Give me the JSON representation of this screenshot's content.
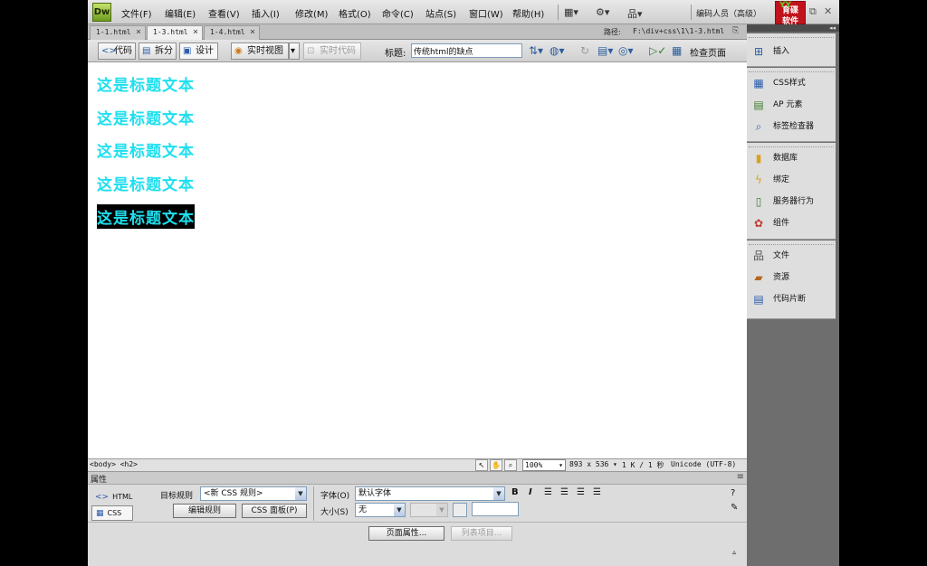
{
  "app": {
    "logo": "Dw",
    "workspace": "编码人员（高级）",
    "brand_line1": "育碟",
    "brand_line2": "软件",
    "brand_top": "YY"
  },
  "menu": [
    "文件(F)",
    "编辑(E)",
    "查看(V)",
    "插入(I)",
    "修改(M)",
    "格式(O)",
    "命令(C)",
    "站点(S)",
    "窗口(W)",
    "帮助(H)"
  ],
  "tabs": [
    {
      "label": "1-1.html",
      "active": false
    },
    {
      "label": "1-3.html",
      "active": true
    },
    {
      "label": "1-4.html",
      "active": false
    }
  ],
  "path": {
    "label": "路径:",
    "value": "F:\\div+css\\1\\1-3.html"
  },
  "doc_toolbar": {
    "code": "代码",
    "split": "拆分",
    "design": "设计",
    "live_view": "实时视图",
    "live_code": "实时代码",
    "title_label": "标题:",
    "title_value": "传统html的缺点",
    "check_page": "检查页面"
  },
  "design": {
    "headings": [
      "这是标题文本",
      "这是标题文本",
      "这是标题文本",
      "这是标题文本",
      "这是标题文本"
    ]
  },
  "status": {
    "tag_selector": "<body> <h2>",
    "zoom": "100%",
    "dimensions": "893 x 536",
    "size": "1 K / 1 秒",
    "encoding": "Unicode (UTF-8)"
  },
  "properties": {
    "title": "属性",
    "html_btn": "HTML",
    "css_btn": "CSS",
    "target_rule_label": "目标规则",
    "target_rule_value": "<新 CSS 规则>",
    "edit_rule": "编辑规则",
    "css_panel": "CSS 面板(P)",
    "font_label": "字体(O)",
    "font_value": "默认字体",
    "size_label": "大小(S)",
    "size_value": "无",
    "bold": "B",
    "italic": "I",
    "page_props": "页面属性...",
    "list_items": "列表项目..."
  },
  "panels": {
    "group1": [
      "插入"
    ],
    "group2": [
      "CSS样式",
      "AP 元素",
      "标签检查器"
    ],
    "group3": [
      "数据库",
      "绑定",
      "服务器行为",
      "组件"
    ],
    "group4": [
      "文件",
      "资源",
      "代码片断"
    ]
  },
  "colors": {
    "heading": "#1fdfee",
    "selection": "#000000",
    "accent": "#2a5caa"
  }
}
